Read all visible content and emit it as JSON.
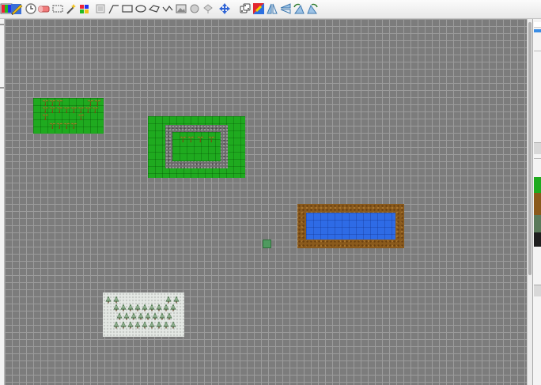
{
  "toolbar": {
    "tools": [
      {
        "name": "layer-rgb-icon"
      },
      {
        "name": "pencil-tool-icon"
      },
      {
        "name": "reset-circle-icon"
      },
      {
        "name": "eraser-icon"
      },
      {
        "name": "rectangle-select-icon"
      },
      {
        "name": "magic-wand-icon"
      },
      {
        "name": "color-picker-icon"
      },
      {
        "name": "stamp-tool-icon"
      },
      {
        "name": "line-tool-icon"
      },
      {
        "name": "rectangle-tool-icon"
      },
      {
        "name": "ellipse-tool-icon"
      },
      {
        "name": "polygon-tool-icon"
      },
      {
        "name": "polyline-tool-icon"
      },
      {
        "name": "image-object-icon"
      },
      {
        "name": "tile-object-icon"
      },
      {
        "name": "template-icon"
      },
      {
        "name": "move-object-icon"
      },
      {
        "name": "random-mode-icon"
      },
      {
        "name": "wang-fill-icon"
      },
      {
        "name": "flip-horizontal-icon"
      },
      {
        "name": "flip-vertical-icon"
      },
      {
        "name": "rotate-left-icon"
      },
      {
        "name": "rotate-right-icon"
      }
    ]
  },
  "map": {
    "background_color": "#7c7c7c",
    "grid_color": "#9c9c9c",
    "regions": [
      {
        "name": "orchard-grass-patch",
        "terrain": "grass",
        "tree_count": 19
      },
      {
        "name": "walled-garden",
        "terrain": "grass",
        "wall": "cobblestone",
        "tree_count": 4
      },
      {
        "name": "pond",
        "terrain": "water",
        "border": "dirt"
      },
      {
        "name": "snow-forest",
        "terrain": "snow",
        "tree_count": 30
      }
    ],
    "cursor": {
      "name": "tile-cursor",
      "color": "#4f9a5f"
    }
  },
  "colors": {
    "grass": "#1faa1f",
    "stone": "#6e6e6e",
    "dirt": "#8a5a1c",
    "water": "#2e6be6",
    "snow": "#e4e8e4",
    "toolbar_bg": "#f0f0f0"
  }
}
